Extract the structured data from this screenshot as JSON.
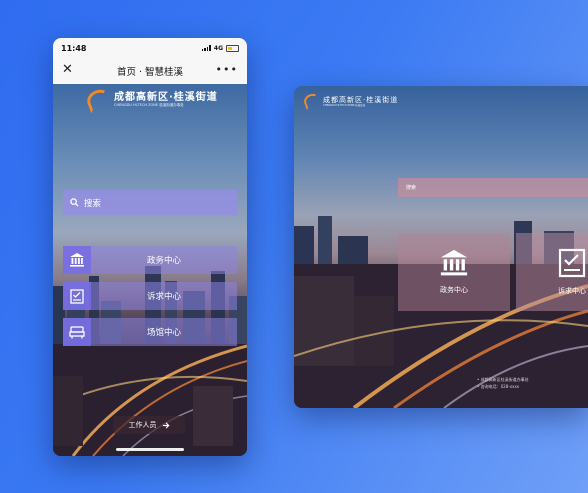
{
  "phone": {
    "status": {
      "time": "11:48",
      "network": "4G"
    },
    "nav": {
      "title": "首页 · 智慧桂溪",
      "close_icon": "close-icon",
      "more_icon": "more-icon"
    },
    "logo": {
      "name": "成都高新区·桂溪街道",
      "subtitle": "CHENGDU HI-TECH ZONE 桂溪街道办事处"
    },
    "search": {
      "placeholder": "搜索"
    },
    "menu": [
      {
        "label": "政务中心",
        "icon": "government-building-icon"
      },
      {
        "label": "诉求中心",
        "icon": "checklist-document-icon"
      },
      {
        "label": "场馆中心",
        "icon": "venue-icon"
      }
    ],
    "staff_button": {
      "label": "工作人员",
      "icon": "arrow-right-icon"
    },
    "accent": "#7b6ee1"
  },
  "tablet": {
    "logo": {
      "name": "成都高新区·桂溪街道",
      "subtitle": "CHENGDU HI-TECH ZONE 桂溪街道"
    },
    "search": {
      "placeholder": "搜索"
    },
    "cards": [
      {
        "label": "政务中心",
        "icon": "government-building-icon"
      },
      {
        "label": "诉求中心",
        "icon": "checklist-document-icon"
      }
    ],
    "footer": [
      "• 成都高新区桂溪街道办事处",
      "• 咨询电话：028-xxxx"
    ]
  }
}
